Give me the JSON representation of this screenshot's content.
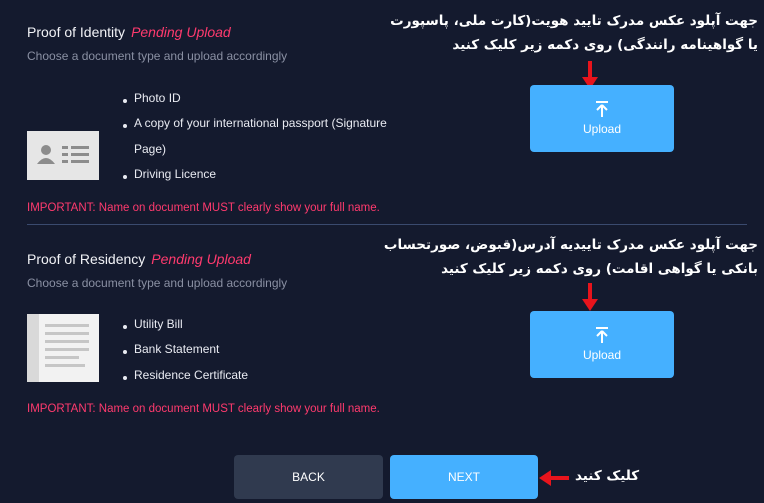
{
  "identity": {
    "title": "Proof of Identity",
    "status": "Pending Upload",
    "subtitle": "Choose a document type and upload accordingly",
    "items": [
      "Photo ID",
      "A copy of your international passport (Signature",
      "Page)",
      "Driving Licence"
    ],
    "important": "IMPORTANT: Name on document MUST clearly show your full name.",
    "upload_label": "Upload",
    "note": [
      "جهت آپلود عکس مدرک تایید هویت(کارت ملی، پاسپورت",
      "یا گواهینامه رانندگی) روی دکمه زیر کلیک کنید"
    ]
  },
  "residency": {
    "title": "Proof of Residency",
    "status": "Pending Upload",
    "subtitle": "Choose a document type and upload accordingly",
    "items": [
      "Utility Bill",
      "Bank Statement",
      "Residence Certificate"
    ],
    "important": "IMPORTANT: Name on document MUST clearly show your full name.",
    "upload_label": "Upload",
    "note": [
      "جهت آپلود عکس مدرک تاییدیه آدرس(قبوض، صورتحساب",
      "بانکی یا گواهی اقامت) روی دکمه زیر کلیک کنید"
    ]
  },
  "actions": {
    "back_label": "BACK",
    "next_label": "NEXT",
    "next_note": "کلیک کنید"
  },
  "colors": {
    "background": "#141a2e",
    "accent": "#45b0ff",
    "warning": "#ff3a6e",
    "arrow": "#e8141c"
  },
  "icons": [
    "upload-arrow-icon",
    "id-card-icon",
    "document-icon",
    "red-arrow-icon"
  ]
}
